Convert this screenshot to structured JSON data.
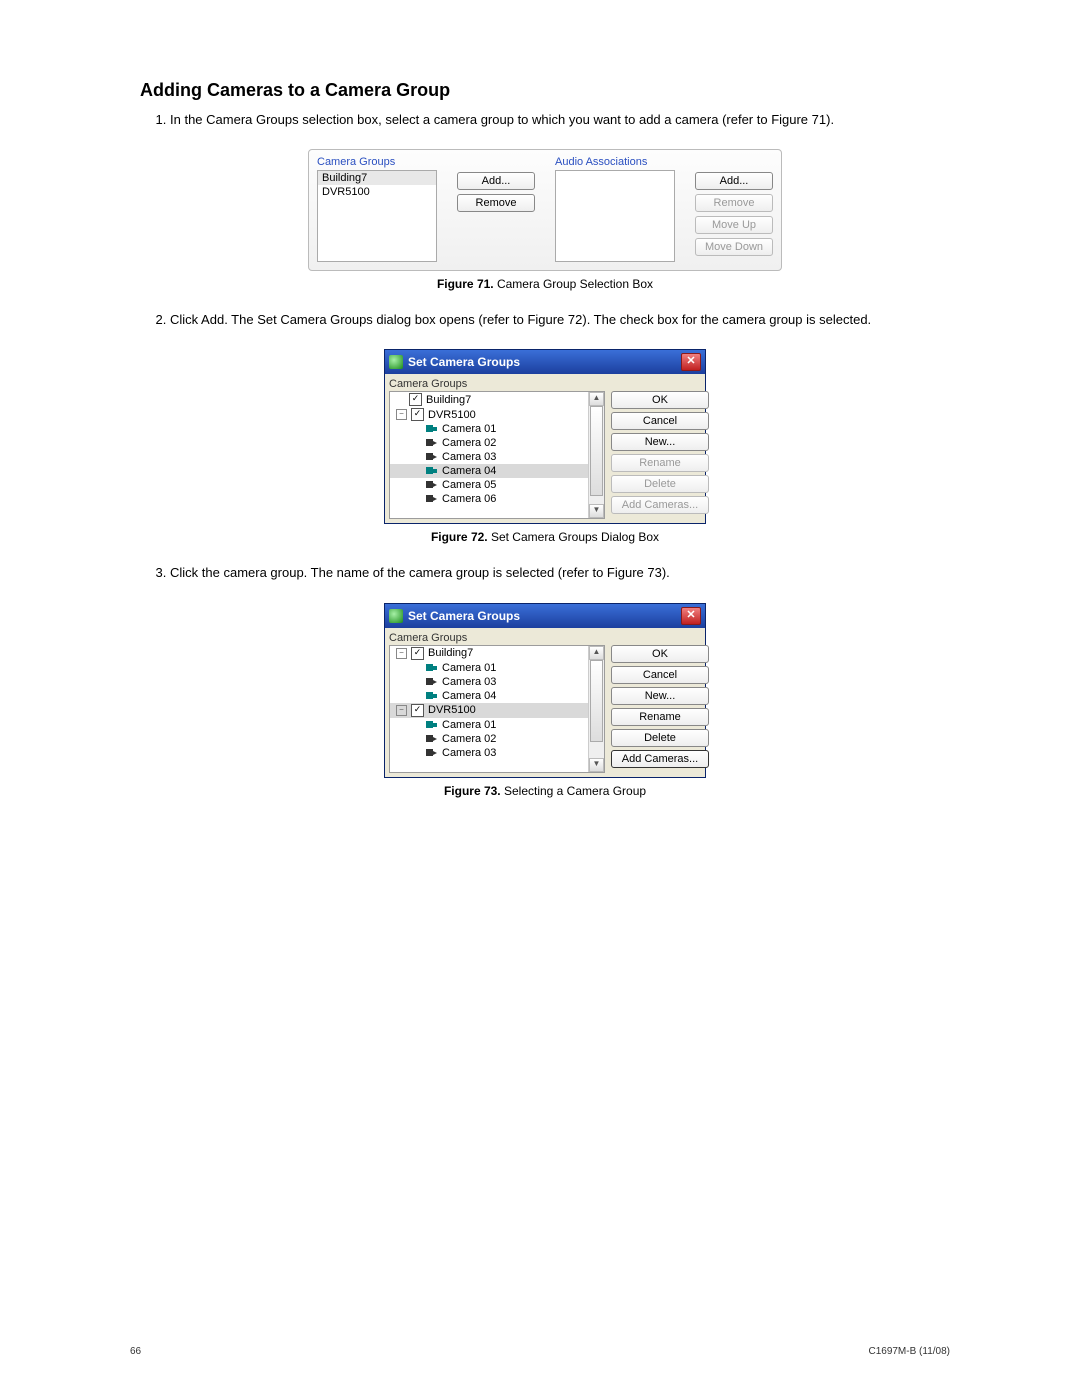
{
  "heading": "Adding Cameras to a Camera Group",
  "step1": "In the Camera Groups selection box, select a camera group to which you want to add a camera (refer to Figure 71).",
  "step2": "Click Add. The Set Camera Groups dialog box opens (refer to Figure 72). The check box for the camera group is selected.",
  "step3": "Click the camera group. The name of the camera group is selected (refer to Figure 73).",
  "fig71": {
    "cameraGroupsLabel": "Camera Groups",
    "audioLabel": "Audio Associations",
    "item1": "Building7",
    "item2": "DVR5100",
    "btnAdd": "Add...",
    "btnRemove": "Remove",
    "btnMoveUp": "Move Up",
    "btnMoveDown": "Move Down",
    "captionBold": "Figure 71.",
    "captionText": "  Camera Group Selection Box"
  },
  "fig72": {
    "title": "Set Camera Groups",
    "treeLabel": "Camera Groups",
    "nodes": {
      "building7": "Building7",
      "dvr5100": "DVR5100",
      "c1": "Camera 01",
      "c2": "Camera 02",
      "c3": "Camera 03",
      "c4": "Camera 04",
      "c5": "Camera 05",
      "c6": "Camera 06"
    },
    "btns": {
      "ok": "OK",
      "cancel": "Cancel",
      "new": "New...",
      "rename": "Rename",
      "delete": "Delete",
      "addcams": "Add Cameras..."
    },
    "captionBold": "Figure 72.",
    "captionText": "  Set Camera Groups Dialog Box"
  },
  "fig73": {
    "title": "Set Camera Groups",
    "treeLabel": "Camera Groups",
    "nodes": {
      "building7": "Building7",
      "c1": "Camera 01",
      "c3": "Camera 03",
      "c4": "Camera 04",
      "dvr5100": "DVR5100",
      "c1b": "Camera 01",
      "c2b": "Camera 02",
      "c3b": "Camera 03"
    },
    "btns": {
      "ok": "OK",
      "cancel": "Cancel",
      "new": "New...",
      "rename": "Rename",
      "delete": "Delete",
      "addcams": "Add Cameras..."
    },
    "captionBold": "Figure 73.",
    "captionText": "  Selecting a Camera Group"
  },
  "footer": {
    "page": "66",
    "doc": "C1697M-B (11/08)"
  }
}
